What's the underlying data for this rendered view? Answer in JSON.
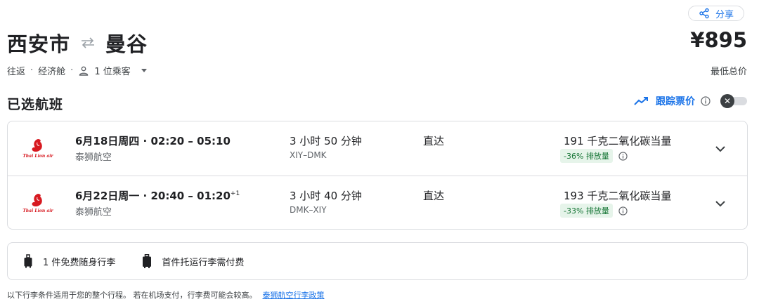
{
  "header": {
    "share_label": "分享",
    "origin": "西安市",
    "destination": "曼谷",
    "price": "¥895",
    "price_label": "最低总价"
  },
  "trip": {
    "trip_type": "往返",
    "cabin": "经济舱",
    "passengers": "1 位乘客",
    "separator": "·"
  },
  "selected": {
    "title": "已选航班",
    "track_label": "跟踪票价",
    "track_toggle_on": false
  },
  "flights": [
    {
      "times": "6月18日周四 · 02:20 – 05:10",
      "day_offset": "",
      "airline": "泰狮航空",
      "duration": "3 小时 50 分钟",
      "airports": "XIY–DMK",
      "stops": "直达",
      "co2": "191 千克二氧化碳当量",
      "emission": "-36% 排放量"
    },
    {
      "times": "6月22日周一 · 20:40 – 01:20",
      "day_offset": "+1",
      "airline": "泰狮航空",
      "duration": "3 小时 40 分钟",
      "airports": "DMK–XIY",
      "stops": "直达",
      "co2": "193 千克二氧化碳当量",
      "emission": "-33% 排放量"
    }
  ],
  "baggage": {
    "carry_on": "1 件免费随身行李",
    "checked": "首件托运行李需付费"
  },
  "footnote": {
    "text": "以下行李条件适用于您的整个行程。 若在机场支付，行李费可能会较高。",
    "link": "泰狮航空行李政策"
  },
  "colors": {
    "accent": "#1a73e8",
    "emission_bg": "#e6f4ea",
    "emission_text": "#137333",
    "logo_red": "#d71920",
    "border": "#dadce0"
  }
}
